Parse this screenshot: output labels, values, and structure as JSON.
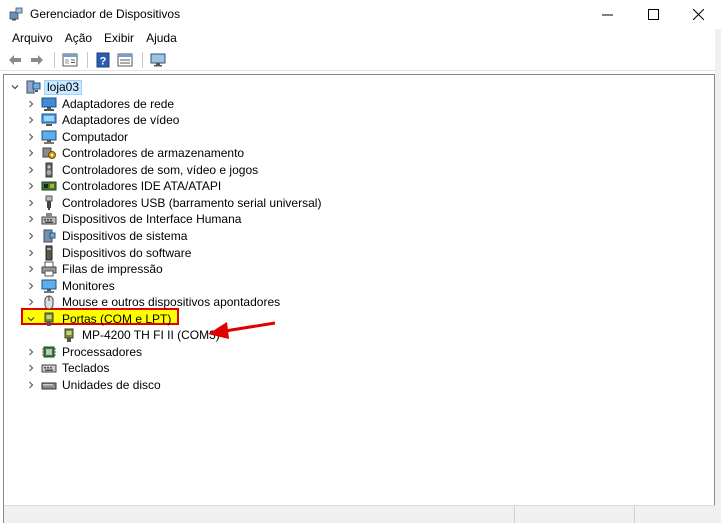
{
  "window": {
    "title": "Gerenciador de Dispositivos",
    "controls": [
      "minimize-icon",
      "maximize-icon",
      "close-icon"
    ]
  },
  "menu": [
    "Arquivo",
    "Ação",
    "Exibir",
    "Ajuda"
  ],
  "toolbar": [
    "back-arrow-icon",
    "forward-arrow-icon",
    "properties-icon",
    "help-icon",
    "details-icon",
    "monitor-icon"
  ],
  "tree": {
    "root": "loja03",
    "categories": [
      {
        "label": "Adaptadores de rede",
        "icon": "network-adapter-icon"
      },
      {
        "label": "Adaptadores de vídeo",
        "icon": "display-adapter-icon"
      },
      {
        "label": "Computador",
        "icon": "computer-icon"
      },
      {
        "label": "Controladores de armazenamento",
        "icon": "storage-controller-icon"
      },
      {
        "label": "Controladores de som, vídeo e jogos",
        "icon": "speaker-icon"
      },
      {
        "label": "Controladores IDE ATA/ATAPI",
        "icon": "ide-controller-icon"
      },
      {
        "label": "Controladores USB (barramento serial universal)",
        "icon": "usb-icon"
      },
      {
        "label": "Dispositivos de Interface Humana",
        "icon": "hid-icon"
      },
      {
        "label": "Dispositivos de sistema",
        "icon": "system-device-icon"
      },
      {
        "label": "Dispositivos do software",
        "icon": "software-device-icon"
      },
      {
        "label": "Filas de impressão",
        "icon": "printer-icon"
      },
      {
        "label": "Monitores",
        "icon": "monitor-icon"
      },
      {
        "label": "Mouse e outros dispositivos apontadores",
        "icon": "mouse-icon"
      },
      {
        "label": "Portas (COM e LPT)",
        "icon": "port-icon",
        "expanded": true
      },
      {
        "label": "Processadores",
        "icon": "processor-icon"
      },
      {
        "label": "Teclados",
        "icon": "keyboard-icon"
      },
      {
        "label": "Unidades de disco",
        "icon": "disk-drive-icon"
      }
    ],
    "port_child": {
      "label": "MP-4200 TH FI II (COM3)",
      "icon": "port-icon"
    }
  },
  "colors": {
    "highlight_border": "#e00000",
    "highlight_fill": "#ffff00",
    "arrow": "#e00000",
    "selection": "#cce8ff"
  }
}
